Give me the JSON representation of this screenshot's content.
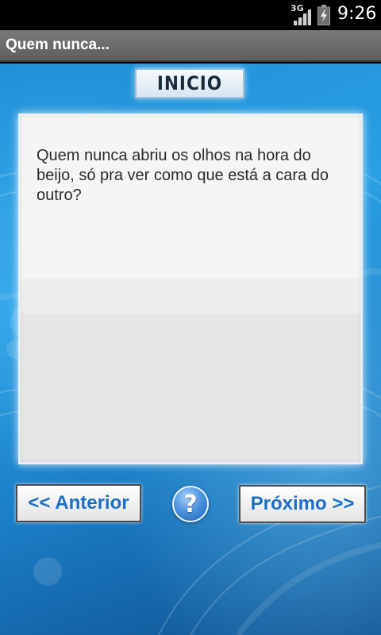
{
  "status_bar": {
    "network": "3G",
    "time": "9:26",
    "icons": [
      "signal-icon",
      "battery-charging-icon"
    ]
  },
  "app": {
    "title": "Quem nunca..."
  },
  "main": {
    "inicio_label": "INICIO",
    "question": "Quem nunca abriu os olhos na hora do beijo, só pra ver como que está a cara do outro?",
    "prev_label": "<< Anterior",
    "help_label": "?",
    "next_label": "Próximo >>"
  },
  "colors": {
    "background": "#1f8fd8",
    "button_text": "#1d6fc4",
    "title_bar": "#6a6a6a"
  }
}
